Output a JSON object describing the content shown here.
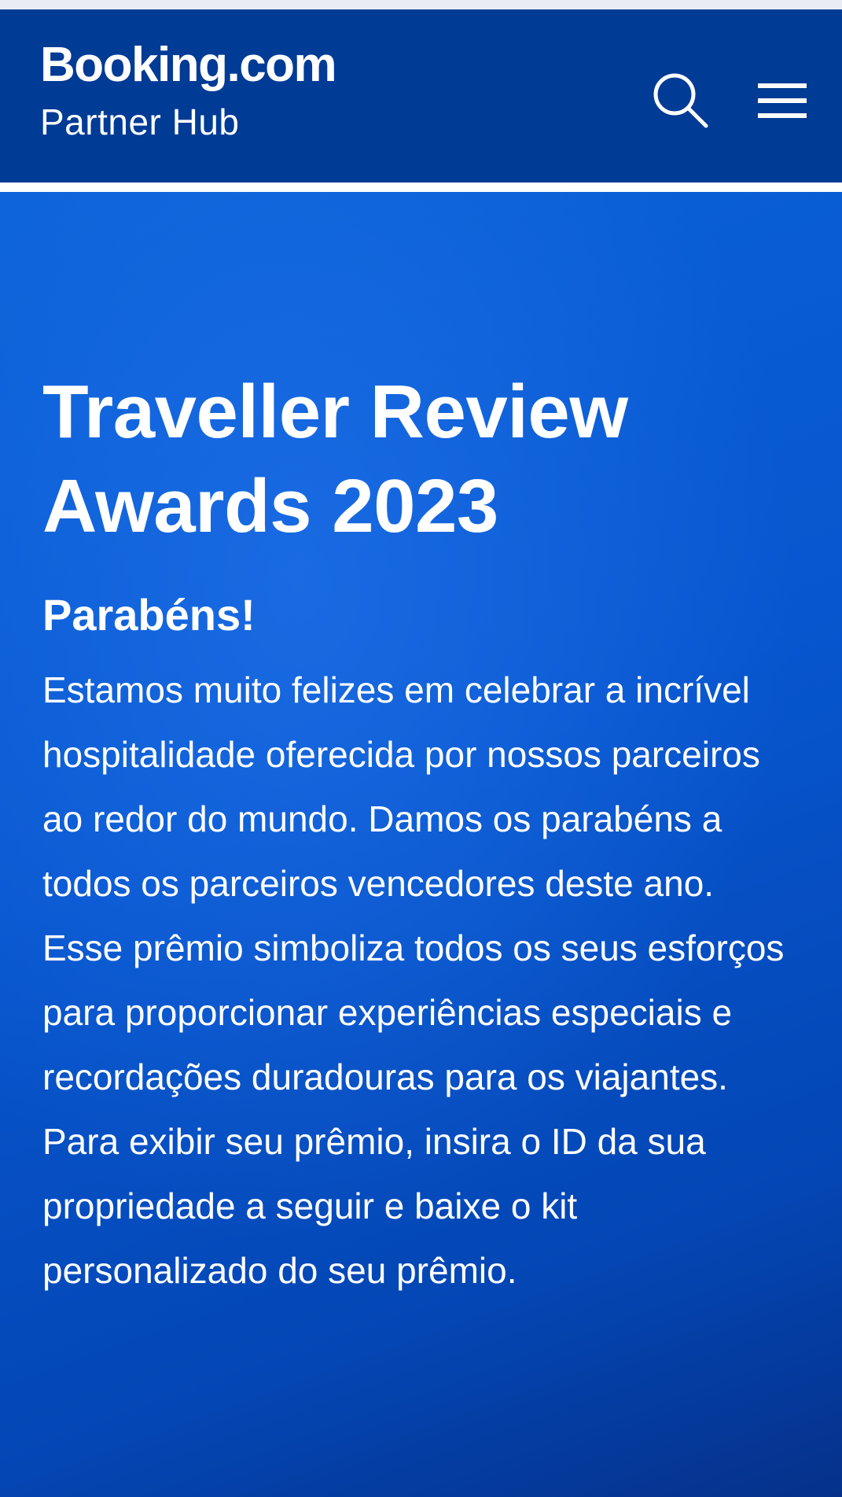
{
  "header": {
    "logo_text": "Booking.com",
    "sub_text": "Partner Hub",
    "search_icon": "search-icon",
    "menu_icon": "hamburger-menu-icon",
    "background_color": "#003b95"
  },
  "hero": {
    "title": "Traveller Review Awards 2023",
    "subtitle": "Parabéns!",
    "body": "Estamos muito felizes em celebrar a incrível hospitalidade oferecida por nossos parceiros ao redor do mundo. Damos os parabéns a todos os parceiros vencedores deste ano. Esse prêmio simboliza todos os seus esforços para proporcionar experiências especiais e recordações duradouras para os viajantes. Para exibir seu prêmio, insira o ID da sua propriedade a seguir e baixe o kit personalizado do seu prêmio.",
    "background_color": "#0756cf",
    "text_color": "#ffffff"
  }
}
